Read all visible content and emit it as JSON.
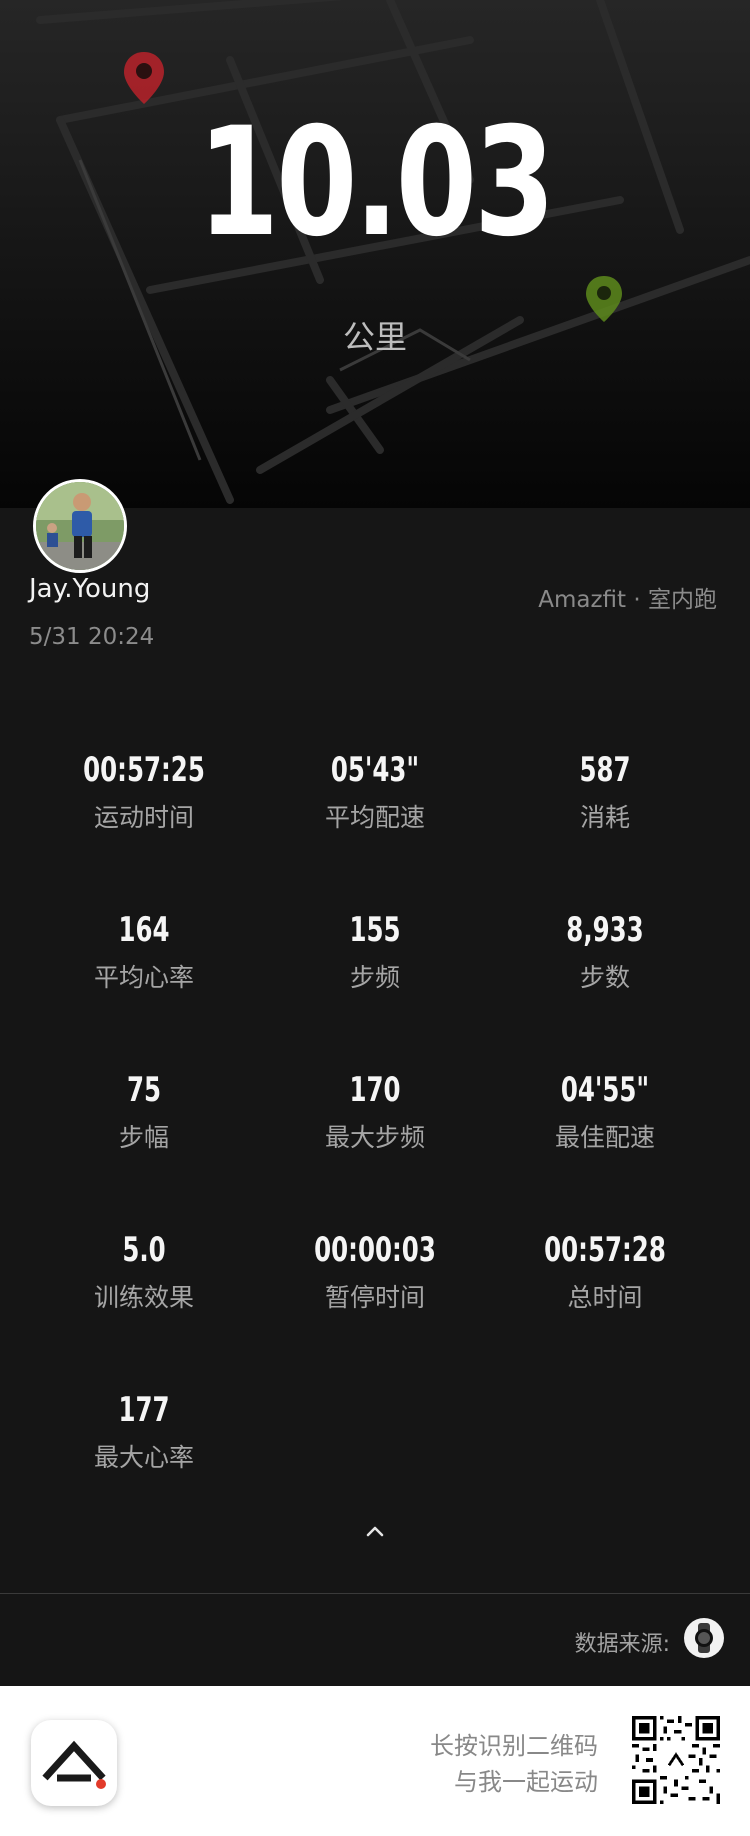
{
  "workout": {
    "distance": "10.03",
    "unit": "公里"
  },
  "profile": {
    "username": "Jay.Young",
    "datetime": "5/31 20:24",
    "device": "Amazfit · 室内跑"
  },
  "stats": [
    {
      "value": "00:57:25",
      "label": "运动时间"
    },
    {
      "value": "05'43\"",
      "label": "平均配速"
    },
    {
      "value": "587",
      "label": "消耗"
    },
    {
      "value": "164",
      "label": "平均心率"
    },
    {
      "value": "155",
      "label": "步频"
    },
    {
      "value": "8,933",
      "label": "步数"
    },
    {
      "value": "75",
      "label": "步幅"
    },
    {
      "value": "170",
      "label": "最大步频"
    },
    {
      "value": "04'55\"",
      "label": "最佳配速"
    },
    {
      "value": "5.0",
      "label": "训练效果"
    },
    {
      "value": "00:00:03",
      "label": "暂停时间"
    },
    {
      "value": "00:57:28",
      "label": "总时间"
    },
    {
      "value": "177",
      "label": "最大心率"
    }
  ],
  "source": {
    "label": "数据来源:"
  },
  "footer": {
    "line1": "长按识别二维码",
    "line2": "与我一起运动"
  },
  "icons": {
    "start_pin": "map-pin-start-icon",
    "end_pin": "map-pin-end-icon",
    "collapse": "chevron-up-icon",
    "watch": "watch-icon",
    "app": "amazfit-app-logo",
    "qr": "qr-code"
  },
  "colors": {
    "start_pin": "#b8222a",
    "end_pin": "#5d8a1c",
    "background": "#151515"
  }
}
